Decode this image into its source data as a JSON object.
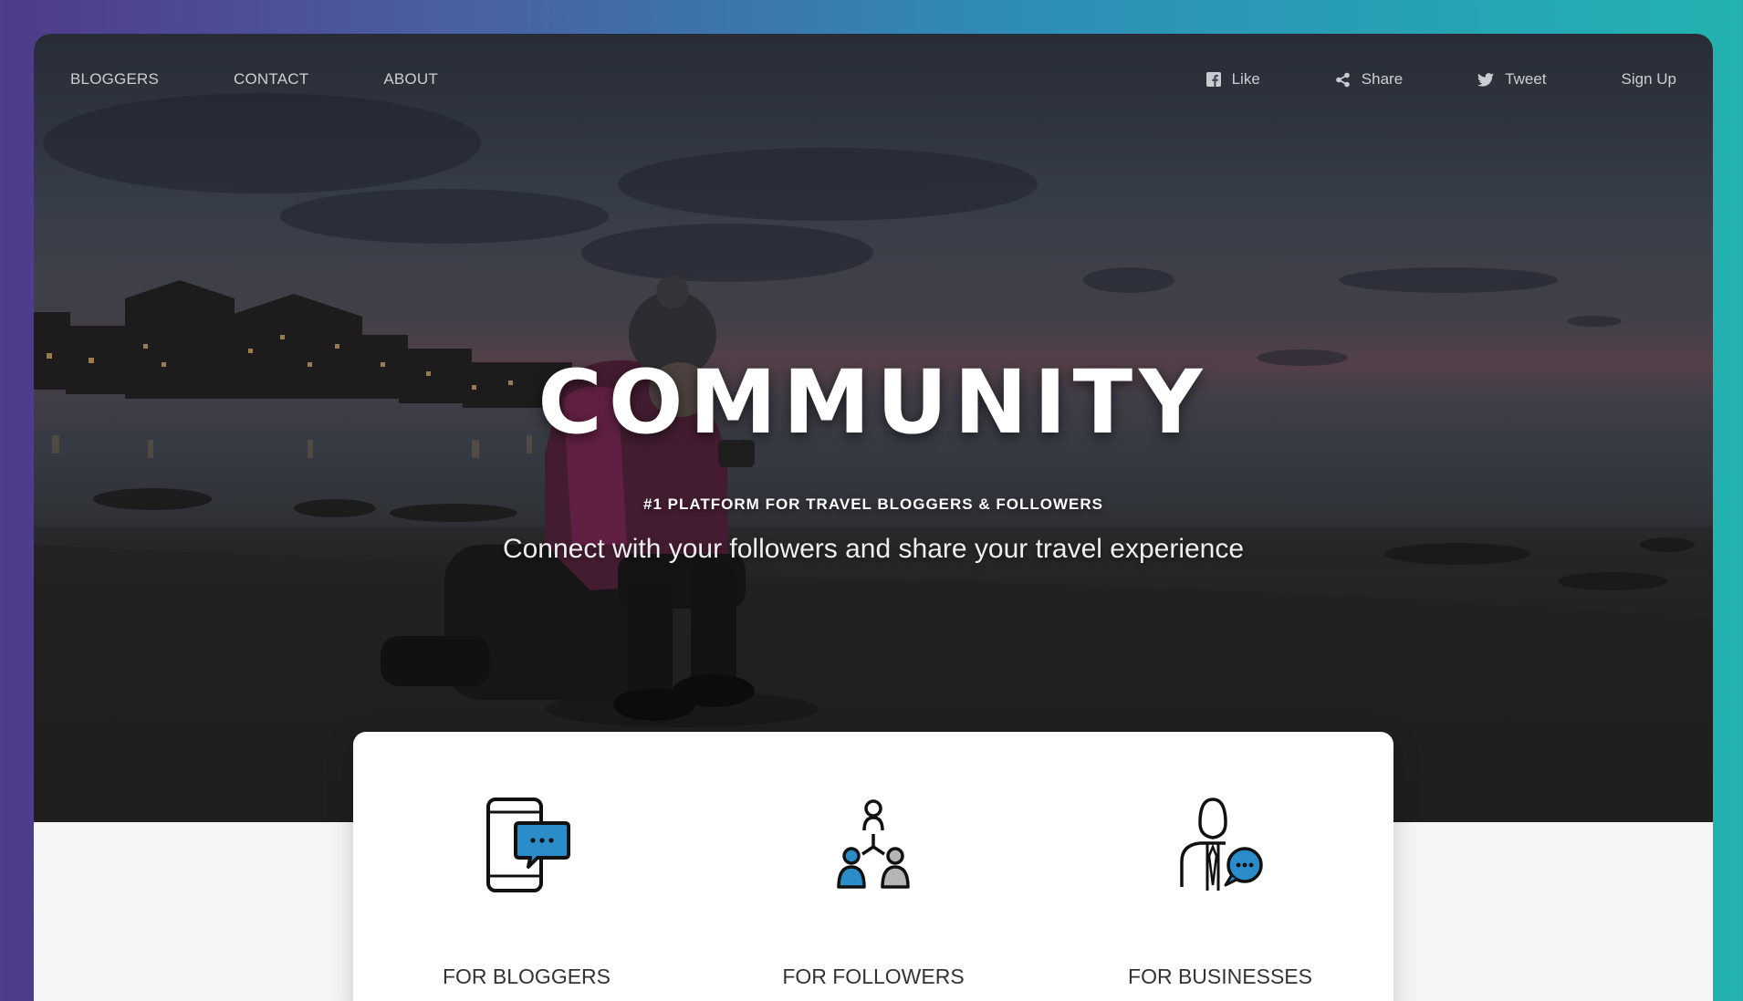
{
  "nav": {
    "left": [
      "BLOGGERS",
      "CONTACT",
      "ABOUT"
    ],
    "like_label": "Like",
    "share_label": "Share",
    "tweet_label": "Tweet",
    "signup_label": "Sign Up"
  },
  "hero": {
    "title": "COMMUNITY",
    "tagline": "#1 PLATFORM FOR TRAVEL BLOGGERS & FOLLOWERS",
    "subtitle": "Connect with your followers and share your travel experience"
  },
  "features": [
    {
      "label": "FOR BLOGGERS",
      "icon": "phone-chat-icon"
    },
    {
      "label": "FOR FOLLOWERS",
      "icon": "network-people-icon"
    },
    {
      "label": "FOR BUSINESSES",
      "icon": "businessman-chat-icon"
    }
  ],
  "colors": {
    "accent": "#2a8cc8",
    "gradient_start": "#4f3a8a",
    "gradient_end": "#22b2b0"
  }
}
